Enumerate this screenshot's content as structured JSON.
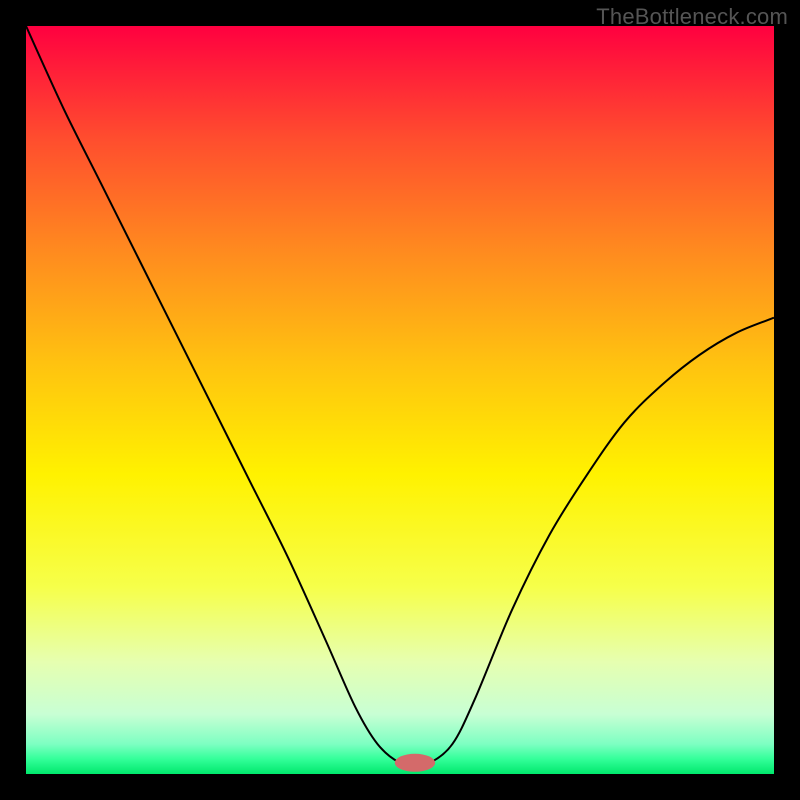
{
  "watermark": "TheBottleneck.com",
  "chart_data": {
    "type": "line",
    "title": "",
    "xlabel": "",
    "ylabel": "",
    "xlim": [
      0,
      100
    ],
    "ylim": [
      0,
      100
    ],
    "background_gradient": {
      "stops": [
        {
          "offset": 0.0,
          "color": "#ff0040"
        },
        {
          "offset": 0.05,
          "color": "#ff1a3a"
        },
        {
          "offset": 0.15,
          "color": "#ff4d2e"
        },
        {
          "offset": 0.3,
          "color": "#ff8a1f"
        },
        {
          "offset": 0.45,
          "color": "#ffc210"
        },
        {
          "offset": 0.6,
          "color": "#fff200"
        },
        {
          "offset": 0.75,
          "color": "#f6ff4a"
        },
        {
          "offset": 0.85,
          "color": "#e6ffb0"
        },
        {
          "offset": 0.92,
          "color": "#c8ffd4"
        },
        {
          "offset": 0.96,
          "color": "#7dffc2"
        },
        {
          "offset": 0.98,
          "color": "#33ff99"
        },
        {
          "offset": 1.0,
          "color": "#00e86c"
        }
      ]
    },
    "series": [
      {
        "name": "bottleneck-curve",
        "color": "#000000",
        "x": [
          0,
          5,
          10,
          15,
          20,
          25,
          30,
          35,
          40,
          44,
          47,
          50,
          52,
          54,
          57,
          60,
          65,
          70,
          75,
          80,
          85,
          90,
          95,
          100
        ],
        "values": [
          100,
          89,
          79,
          69,
          59,
          49,
          39,
          29,
          18,
          9,
          4,
          1.5,
          1.5,
          1.5,
          4,
          10,
          22,
          32,
          40,
          47,
          52,
          56,
          59,
          61
        ]
      }
    ],
    "marker": {
      "x": 52,
      "y": 1.5,
      "rx": 2.7,
      "ry": 1.2,
      "color": "#d46a6a"
    }
  }
}
